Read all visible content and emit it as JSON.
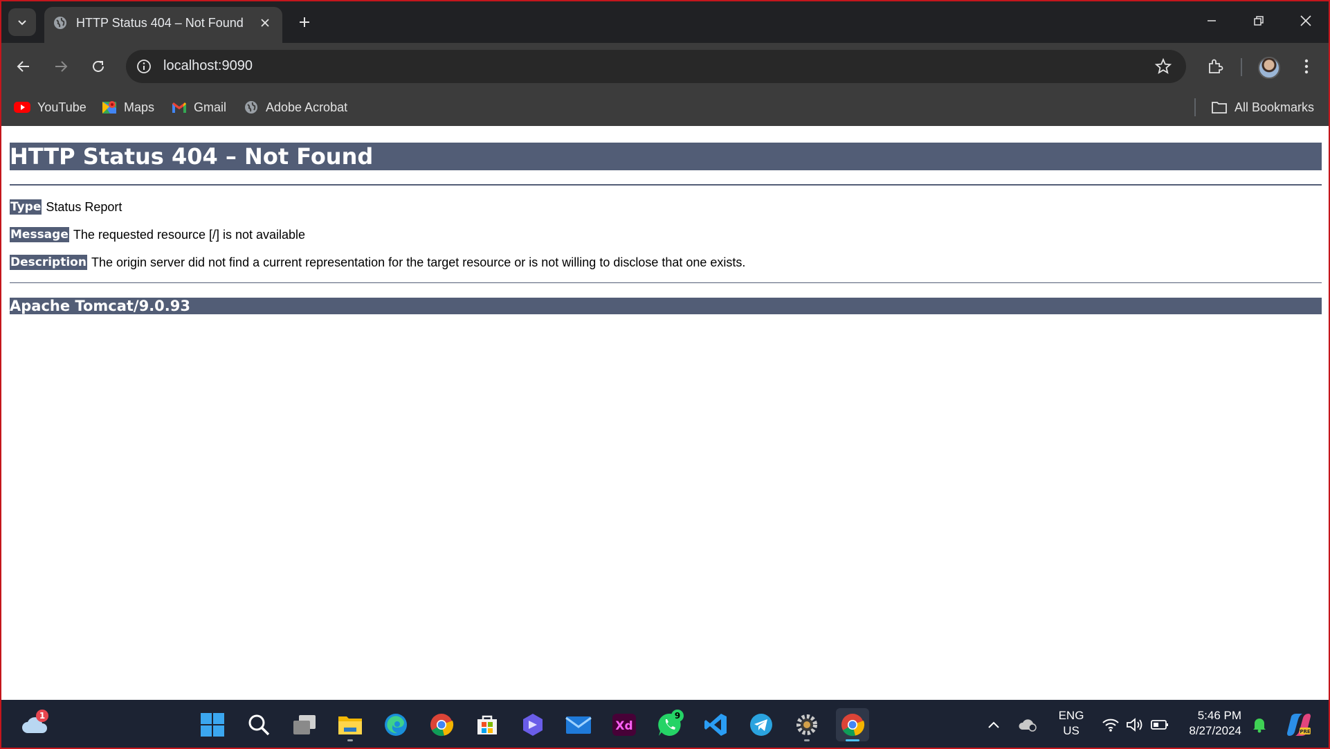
{
  "browser": {
    "tab_title": "HTTP Status 404 – Not Found",
    "url": "localhost:9090",
    "bookmarks": [
      {
        "label": "YouTube",
        "icon": "youtube-icon"
      },
      {
        "label": "Maps",
        "icon": "maps-icon"
      },
      {
        "label": "Gmail",
        "icon": "gmail-icon"
      },
      {
        "label": "Adobe Acrobat",
        "icon": "globe-icon"
      }
    ],
    "all_bookmarks": "All Bookmarks"
  },
  "page": {
    "title": "HTTP Status 404 – Not Found",
    "rows": [
      {
        "label": "Type",
        "value": "Status Report"
      },
      {
        "label": "Message",
        "value": "The requested resource [/] is not available"
      },
      {
        "label": "Description",
        "value": "The origin server did not find a current representation for the target resource or is not willing to disclose that one exists."
      }
    ],
    "footer": "Apache Tomcat/9.0.93"
  },
  "taskbar": {
    "weather_badge": "1",
    "whatsapp_badge": "9",
    "language": "ENG",
    "region": "US",
    "time": "5:46 PM",
    "date": "8/27/2024"
  },
  "colors": {
    "tomcat_header": "#525d76",
    "accent": "#4cc2ff"
  }
}
